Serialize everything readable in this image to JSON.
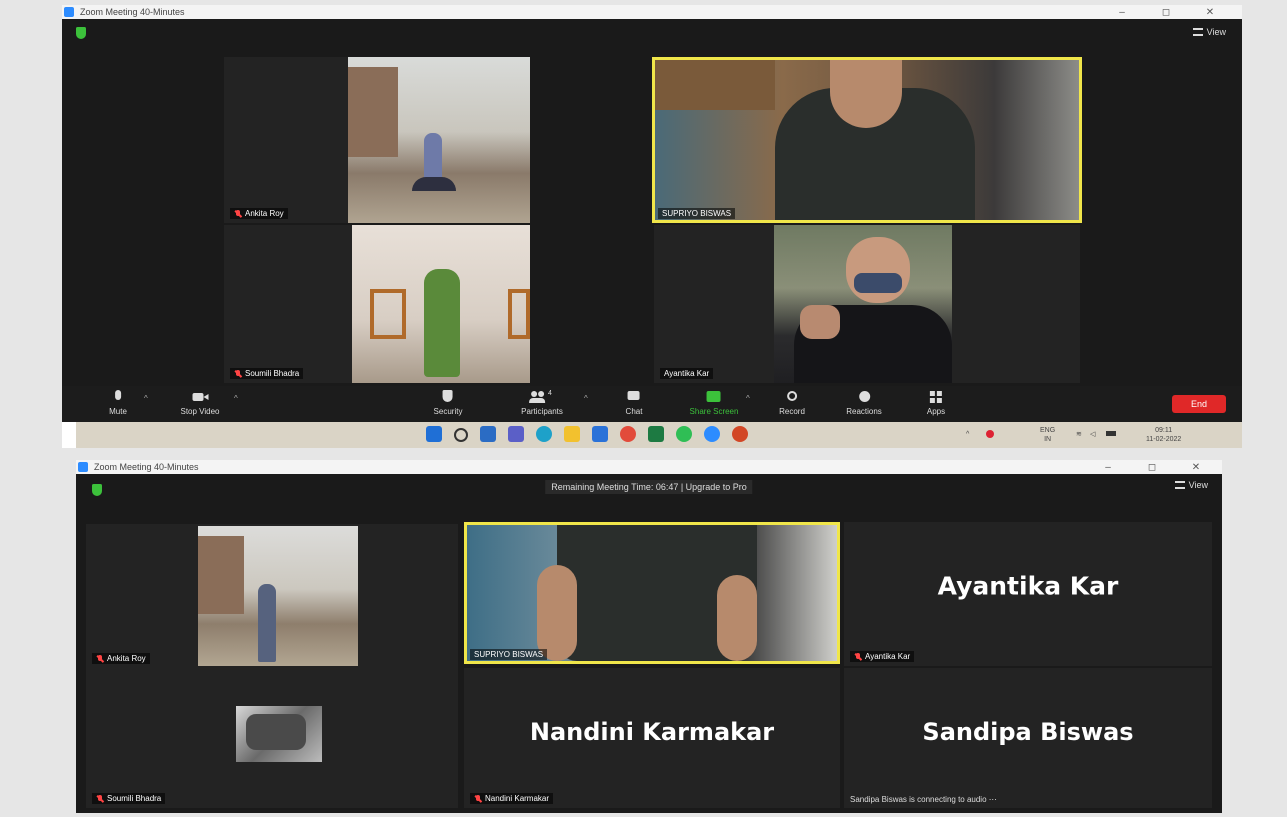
{
  "top": {
    "window_title": "Zoom Meeting 40-Minutes",
    "view_label": "View",
    "participants": [
      {
        "name": "Ankita Roy",
        "muted": true
      },
      {
        "name": "SUPRIYO BISWAS",
        "muted": false,
        "active_speaker": true
      },
      {
        "name": "Soumili Bhadra",
        "muted": true
      },
      {
        "name": "Ayantika Kar",
        "muted": false
      }
    ],
    "toolbar": {
      "mute": "Mute",
      "stop_video": "Stop Video",
      "security": "Security",
      "participants": "Participants",
      "participants_count": "4",
      "chat": "Chat",
      "share_screen": "Share Screen",
      "record": "Record",
      "reactions": "Reactions",
      "apps": "Apps",
      "end": "End"
    },
    "taskbar": {
      "lang_line1": "ENG",
      "lang_line2": "IN",
      "time": "09:11",
      "date": "11-02-2022"
    }
  },
  "bottom": {
    "window_title": "Zoom Meeting 40-Minutes",
    "view_label": "View",
    "banner": "Remaining Meeting Time: 06:47 | Upgrade to Pro",
    "participants": [
      {
        "name": "Ankita Roy",
        "muted": true
      },
      {
        "name": "SUPRIYO BISWAS",
        "muted": false,
        "active_speaker": true
      },
      {
        "name": "Ayantika Kar",
        "display_name": "Ayantika Kar",
        "muted": true
      },
      {
        "name": "Soumili Bhadra",
        "muted": true
      },
      {
        "name": "Nandini Karmakar",
        "display_name": "Nandini Karmakar",
        "muted": true
      },
      {
        "name": "Sandipa Biswas",
        "display_name": "Sandipa Biswas",
        "status": "Sandipa Biswas is connecting to audio"
      }
    ]
  },
  "icons": [
    "shield-icon",
    "view-icon",
    "mic-icon",
    "camera-icon",
    "participants-icon",
    "chat-icon",
    "share-screen-icon",
    "record-icon",
    "reactions-icon",
    "apps-icon",
    "windows-start-icon",
    "search-icon",
    "wifi-icon",
    "volume-icon",
    "battery-icon"
  ],
  "colors": {
    "active_border": "#f0e64a",
    "end_button": "#e02828",
    "share_green": "#3cc13b",
    "stage_bg": "#1a1a1a"
  }
}
